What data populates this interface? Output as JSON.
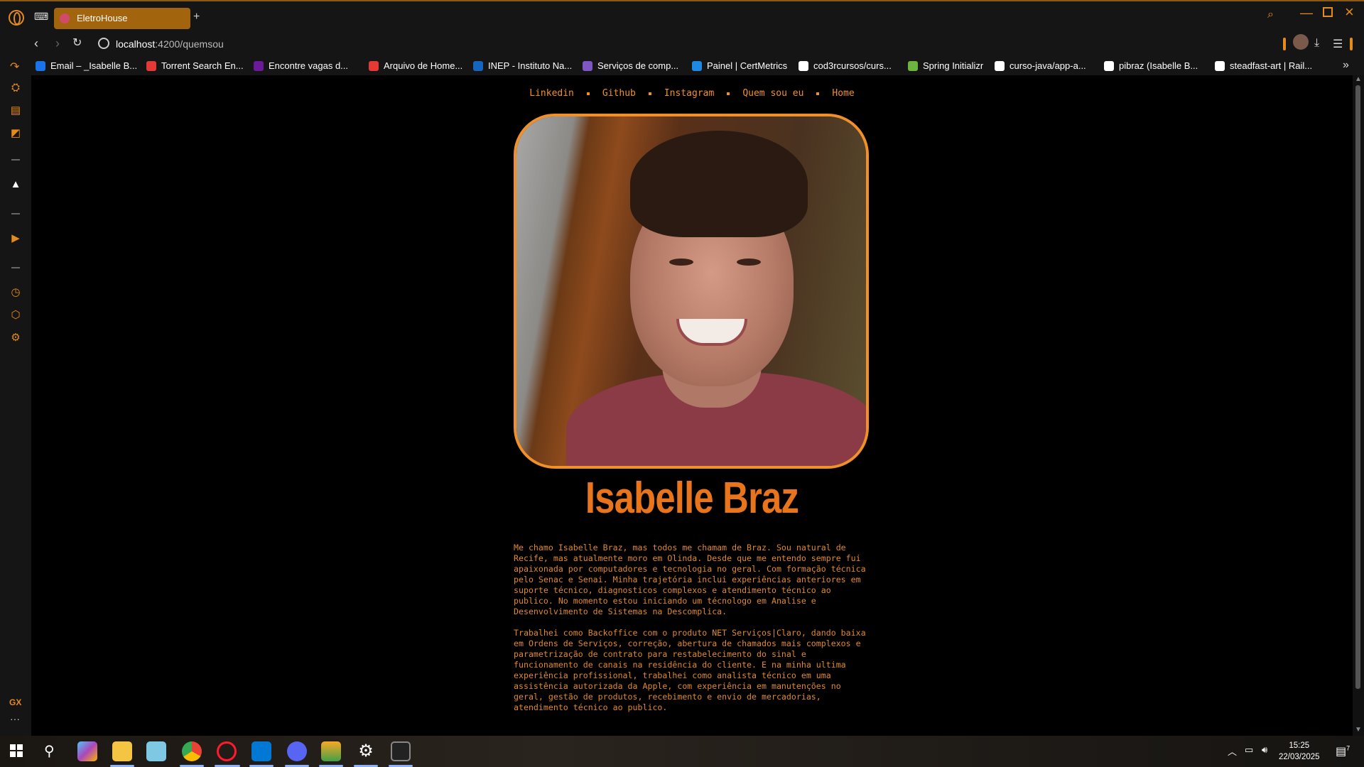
{
  "browser": {
    "tab_title": "EletroHouse",
    "url_host": "localhost",
    "url_path": ":4200/quemsou",
    "accent": "#e58a1c"
  },
  "bookmarks": [
    {
      "label": "Email – _Isabelle B...",
      "icon_color": "#1a73e8"
    },
    {
      "label": "Torrent Search En...",
      "icon_color": "#e53935"
    },
    {
      "label": "Encontre vagas d...",
      "icon_color": "#6a1b9a"
    },
    {
      "label": "Arquivo de Home...",
      "icon_color": "#e53935"
    },
    {
      "label": "INEP - Instituto Na...",
      "icon_color": "#1565c0"
    },
    {
      "label": "Serviços de comp...",
      "icon_color": "#7e57c2"
    },
    {
      "label": "Painel | CertMetrics",
      "icon_color": "#1e88e5"
    },
    {
      "label": "cod3rcursos/curs...",
      "icon_color": "#ffffff"
    },
    {
      "label": "Spring Initializr",
      "icon_color": "#6db33f"
    },
    {
      "label": "curso-java/app-a...",
      "icon_color": "#ffffff"
    },
    {
      "label": "pibraz (Isabelle B...",
      "icon_color": "#ffffff"
    },
    {
      "label": "steadfast-art | Rail...",
      "icon_color": "#ffffff"
    }
  ],
  "page": {
    "nav": [
      "Linkedin",
      "Github",
      "Instagram",
      "Quem sou eu",
      "Home"
    ],
    "name": "Isabelle Braz",
    "bio": [
      "Me chamo Isabelle Braz, mas todos me chamam de Braz. Sou natural de Recife, mas atualmente moro em Olinda. Desde que me entendo sempre fui apaixonada por computadores e tecnologia no geral. Com formação técnica pelo Senac e Senai. Minha trajetória inclui experiências anteriores em suporte técnico, diagnosticos complexos e atendimento técnico ao publico. No momento estou iniciando um técnologo em Analise e Desenvolvimento de Sistemas na Descomplica.",
      "Trabalhei como Backoffice com o produto NET Serviços|Claro, dando baixa em Ordens de Serviços, correção, abertura de chamados mais complexos e parametrização de contrato para restabelecimento do sinal e funcionamento de canais na residência do cliente. E na minha ultima experiência profissional, trabalhei como analista técnico em uma assistência autorizada da Apple, com experiência em manutenções no geral, gestão de produtos, recebimento e envio de mercadorias, atendimento técnico ao publico."
    ],
    "accent": "#f0902a"
  },
  "taskbar": {
    "time": "15:25",
    "date": "22/03/2025",
    "notification_count": "7"
  }
}
